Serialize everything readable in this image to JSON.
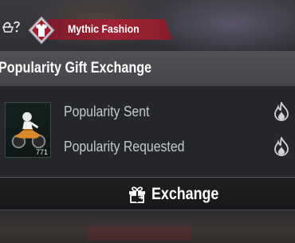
{
  "topbar": {
    "tab_label": "Mythic Fashion",
    "accent_color": "#a02334",
    "icons": [
      "wardrobe-icon",
      "mythic-fashion-badge-icon"
    ]
  },
  "panel": {
    "title": "Popularity Gift Exchange",
    "item": {
      "count": "771",
      "icon": "motorcycle-rider-icon"
    },
    "rows": [
      {
        "label": "Popularity Sent",
        "icon": "flame-icon"
      },
      {
        "label": "Popularity Requested",
        "icon": "flame-icon"
      }
    ],
    "exchange_button": {
      "label": "Exchange",
      "icon": "gift-icon"
    }
  }
}
